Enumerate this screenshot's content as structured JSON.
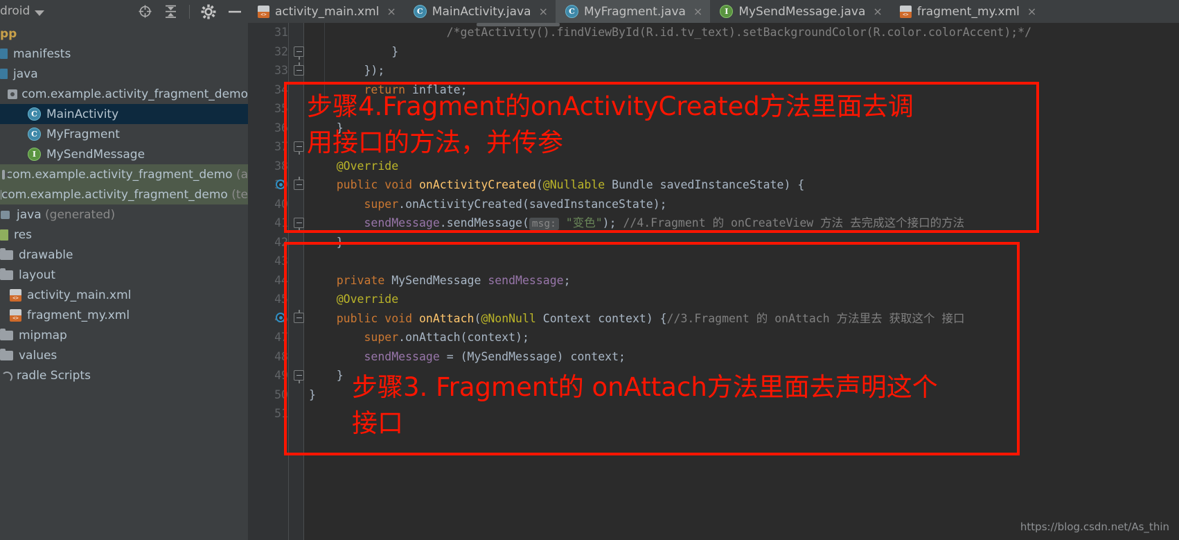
{
  "left_panel": {
    "title": "droid",
    "caret_icon": "chevron-down-icon",
    "toolbar_icons": [
      "target-locate-icon",
      "collapse-all-icon",
      "gear-icon",
      "minimize-icon"
    ],
    "tree": [
      {
        "label": "pp",
        "icon": "app-module-icon",
        "indent": 0,
        "color": "#c9a14a",
        "bold": true,
        "state": "normal"
      },
      {
        "label": "manifests",
        "icon": "folder-blue-icon",
        "indent": 0,
        "state": "normal"
      },
      {
        "label": "java",
        "icon": "folder-blue-icon",
        "indent": 0,
        "state": "normal"
      },
      {
        "label": "com.example.activity_fragment_demo",
        "icon": "package-icon",
        "indent": 1,
        "state": "normal"
      },
      {
        "label": "MainActivity",
        "icon": "java-class-icon",
        "indent": 2,
        "state": "selected"
      },
      {
        "label": "MyFragment",
        "icon": "java-class-icon",
        "indent": 2,
        "state": "normal"
      },
      {
        "label": "MySendMessage",
        "icon": "java-interface-icon",
        "indent": 2,
        "state": "normal"
      },
      {
        "label": "com.example.activity_fragment_demo ",
        "suffix": "(a",
        "icon": "package-icon",
        "indent": 1,
        "state": "green"
      },
      {
        "label": "com.example.activity_fragment_demo ",
        "suffix": "(te",
        "icon": "package-icon",
        "indent": 1,
        "state": "green"
      },
      {
        "label": "java ",
        "suffix": "(generated)",
        "icon": "java-generated-icon",
        "indent": 0,
        "state": "normal"
      },
      {
        "label": "res",
        "icon": "res-icon",
        "indent": 0,
        "state": "normal"
      },
      {
        "label": "drawable",
        "icon": "folder-icon",
        "indent": 0,
        "state": "normal"
      },
      {
        "label": "layout",
        "icon": "folder-icon",
        "indent": 0,
        "state": "normal"
      },
      {
        "label": "activity_main.xml",
        "icon": "xml-file-icon",
        "indent": 1,
        "state": "normal"
      },
      {
        "label": "fragment_my.xml",
        "icon": "xml-file-icon",
        "indent": 1,
        "state": "normal"
      },
      {
        "label": "mipmap",
        "icon": "folder-icon",
        "indent": 0,
        "state": "normal"
      },
      {
        "label": "values",
        "icon": "folder-icon",
        "indent": 0,
        "state": "normal"
      },
      {
        "label": "radle Scripts",
        "icon": "gradle-icon",
        "indent": 0,
        "state": "normal"
      }
    ]
  },
  "tabs": [
    {
      "label": "activity_main.xml",
      "icon": "xml-file-icon",
      "active": false,
      "close": "×"
    },
    {
      "label": "MainActivity.java",
      "icon": "java-class-icon",
      "active": false,
      "close": "×"
    },
    {
      "label": "MyFragment.java",
      "icon": "java-class-icon",
      "active": true,
      "close": "×"
    },
    {
      "label": "MySendMessage.java",
      "icon": "java-interface-icon",
      "active": false,
      "close": "×"
    },
    {
      "label": "fragment_my.xml",
      "icon": "xml-file-icon",
      "active": false,
      "close": "×"
    }
  ],
  "editor": {
    "lines": [
      {
        "num": "31",
        "segments": [
          {
            "t": "                    /*getActivity().findViewById(R.id.tv_text).setBackgroundColor(R.color.colorAccent);*/",
            "c": "t-cmt"
          }
        ]
      },
      {
        "num": "32",
        "segments": [
          {
            "t": "            }",
            "c": "t-plain"
          }
        ]
      },
      {
        "num": "33",
        "segments": [
          {
            "t": "        });",
            "c": "t-plain"
          }
        ]
      },
      {
        "num": "34",
        "segments": [
          {
            "t": "        ",
            "c": "t-plain"
          },
          {
            "t": "return",
            "c": "t-kw"
          },
          {
            "t": " inflate;",
            "c": "t-plain"
          }
        ]
      },
      {
        "num": "35",
        "segments": []
      },
      {
        "num": "36",
        "segments": [
          {
            "t": "    }",
            "c": "t-plain"
          }
        ]
      },
      {
        "num": "37",
        "segments": []
      },
      {
        "num": "38",
        "segments": [
          {
            "t": "    @Override",
            "c": "t-ann"
          }
        ]
      },
      {
        "num": "39",
        "segments": [
          {
            "t": "    ",
            "c": "t-plain"
          },
          {
            "t": "public void ",
            "c": "t-kw"
          },
          {
            "t": "onActivityCreated",
            "c": "t-meth"
          },
          {
            "t": "(",
            "c": "t-plain"
          },
          {
            "t": "@Nullable",
            "c": "t-ann"
          },
          {
            "t": " Bundle savedInstanceState) {",
            "c": "t-plain"
          }
        ]
      },
      {
        "num": "40",
        "segments": [
          {
            "t": "        ",
            "c": "t-plain"
          },
          {
            "t": "super",
            "c": "t-kw"
          },
          {
            "t": ".onActivityCreated(savedInstanceState);",
            "c": "t-plain"
          }
        ]
      },
      {
        "num": "41",
        "segments": [
          {
            "t": "        ",
            "c": "t-plain"
          },
          {
            "t": "sendMessage",
            "c": "t-field"
          },
          {
            "t": ".sendMessage(",
            "c": "t-plain"
          },
          {
            "t": "msg:",
            "c": "t-hint"
          },
          {
            "t": " ",
            "c": "t-plain"
          },
          {
            "t": "\"变色\"",
            "c": "t-str"
          },
          {
            "t": ");",
            "c": "t-plain"
          },
          {
            "t": " //4.Fragment 的 onCreateView 方法 去完成这个接口的方法",
            "c": "t-cmt"
          }
        ]
      },
      {
        "num": "42",
        "segments": [
          {
            "t": "    }",
            "c": "t-plain"
          }
        ]
      },
      {
        "num": "43",
        "segments": []
      },
      {
        "num": "44",
        "segments": [
          {
            "t": "    ",
            "c": "t-plain"
          },
          {
            "t": "private ",
            "c": "t-kw"
          },
          {
            "t": "MySendMessage ",
            "c": "t-type"
          },
          {
            "t": "sendMessage",
            "c": "t-field"
          },
          {
            "t": ";",
            "c": "t-plain"
          }
        ]
      },
      {
        "num": "45",
        "segments": [
          {
            "t": "    @Override",
            "c": "t-ann"
          }
        ]
      },
      {
        "num": "46",
        "segments": [
          {
            "t": "    ",
            "c": "t-plain"
          },
          {
            "t": "public void ",
            "c": "t-kw"
          },
          {
            "t": "onAttach",
            "c": "t-meth"
          },
          {
            "t": "(",
            "c": "t-plain"
          },
          {
            "t": "@NonNull",
            "c": "t-ann"
          },
          {
            "t": " Context context) {",
            "c": "t-plain"
          },
          {
            "t": "//3.Fragment 的 onAttach 方法里去 获取这个 接口",
            "c": "t-cmt"
          }
        ]
      },
      {
        "num": "47",
        "segments": [
          {
            "t": "        ",
            "c": "t-plain"
          },
          {
            "t": "super",
            "c": "t-kw"
          },
          {
            "t": ".onAttach(context);",
            "c": "t-plain"
          }
        ]
      },
      {
        "num": "48",
        "segments": [
          {
            "t": "        ",
            "c": "t-plain"
          },
          {
            "t": "sendMessage",
            "c": "t-field"
          },
          {
            "t": " = (MySendMessage) context;",
            "c": "t-plain"
          }
        ]
      },
      {
        "num": "49",
        "segments": [
          {
            "t": "    }",
            "c": "t-plain"
          }
        ]
      },
      {
        "num": "50",
        "segments": [
          {
            "t": "}",
            "c": "t-plain"
          }
        ]
      },
      {
        "num": "51",
        "segments": []
      }
    ]
  },
  "annotations": [
    {
      "id": "annotation-step4",
      "text": "步骤4.Fragment的onActivityCreated方法里面去调\n用接口的方法，并传参",
      "color": "#ff1500"
    },
    {
      "id": "annotation-step3",
      "text": "步骤3. Fragment的 onAttach方法里面去声明这个\n接口",
      "color": "#ff1500"
    }
  ],
  "watermark": "https://blog.csdn.net/As_thin",
  "colors": {
    "editor_bg": "#2b2b2b",
    "panel_bg": "#3c3f41",
    "gutter_bg": "#313335",
    "selection_blue": "#0d293e",
    "annotation_red": "#ff1500",
    "tab_active": "#4e5254"
  }
}
